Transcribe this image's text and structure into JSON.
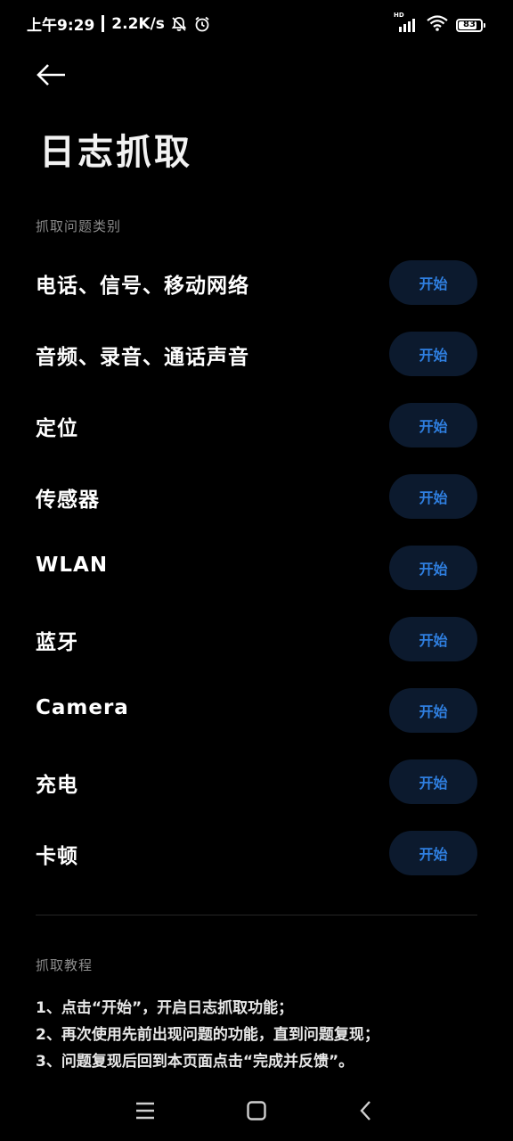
{
  "status_bar": {
    "time": "上午9:29",
    "net_speed": "2.2K/s",
    "network_type": "HD",
    "battery_level": "83",
    "battery_fraction": 0.83,
    "icons": [
      "muted-bell-icon",
      "alarm-clock-icon",
      "hd-signal-icon",
      "wifi-icon",
      "battery-icon"
    ]
  },
  "header": {
    "back_icon": "arrow-left-icon",
    "title": "日志抓取"
  },
  "categories": {
    "heading": "抓取问题类别",
    "items": [
      {
        "label": "电话、信号、移动网络",
        "button": "开始"
      },
      {
        "label": "音频、录音、通话声音",
        "button": "开始"
      },
      {
        "label": "定位",
        "button": "开始"
      },
      {
        "label": "传感器",
        "button": "开始"
      },
      {
        "label": "WLAN",
        "button": "开始"
      },
      {
        "label": "蓝牙",
        "button": "开始"
      },
      {
        "label": "Camera",
        "button": "开始"
      },
      {
        "label": "充电",
        "button": "开始"
      },
      {
        "label": "卡顿",
        "button": "开始"
      }
    ]
  },
  "tutorial": {
    "heading": "抓取教程",
    "steps": [
      "1、点击“开始”，开启日志抓取功能；",
      "2、再次使用先前出现问题的功能，直到问题复现；",
      "3、问题复现后回到本页面点击“完成并反馈”。"
    ]
  },
  "nav_bar": {
    "icons": [
      "menu-icon",
      "home-icon",
      "back-icon"
    ]
  },
  "colors": {
    "background": "#000000",
    "accent": "#2f7fe0",
    "button_bg": "#0c1a2e",
    "muted_text": "#8c8c8c"
  }
}
